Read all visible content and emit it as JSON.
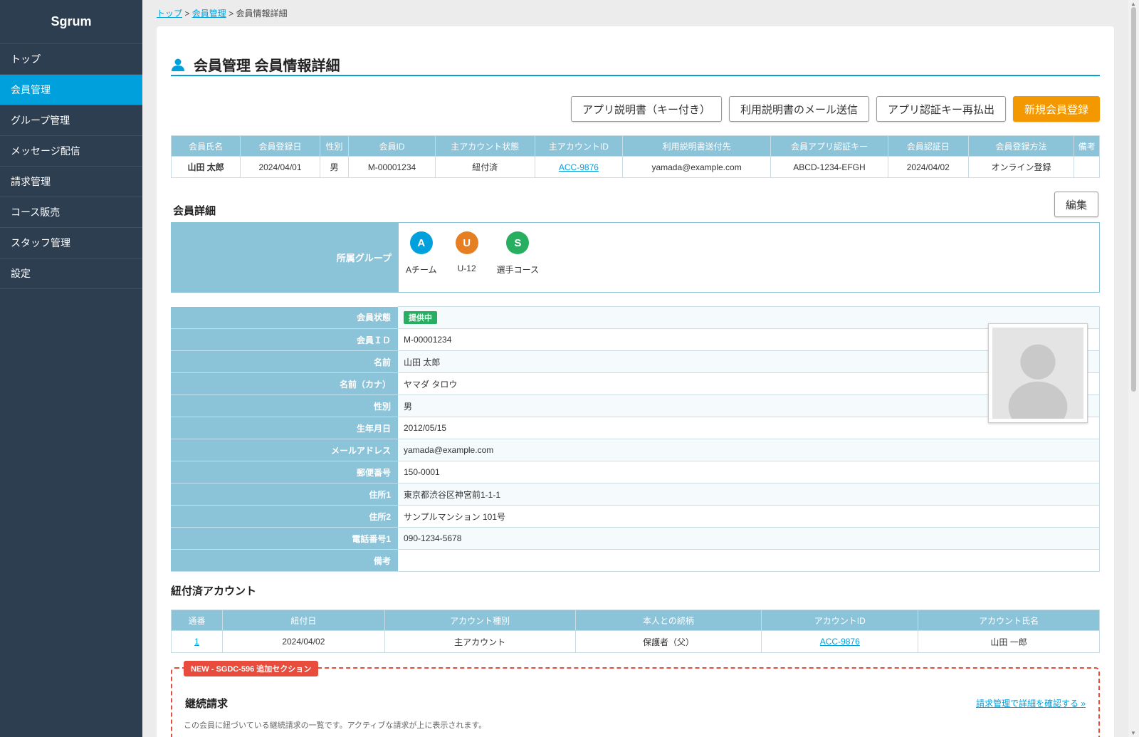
{
  "app": {
    "brand": "Sgrum"
  },
  "sidebar": {
    "items": [
      {
        "label": "トップ"
      },
      {
        "label": "会員管理",
        "active": true
      },
      {
        "label": "グループ管理"
      },
      {
        "label": "メッセージ配信"
      },
      {
        "label": "請求管理"
      },
      {
        "label": "コース販売"
      },
      {
        "label": "スタッフ管理"
      },
      {
        "label": "設定"
      }
    ]
  },
  "breadcrumb": {
    "top": "トップ",
    "sep": ">",
    "members": "会員管理",
    "current": "会員情報詳細"
  },
  "page": {
    "title": "会員管理 会員情報詳細"
  },
  "actions": {
    "manual_with_key": "アプリ説明書（キー付き）",
    "send_manual_mail": "利用説明書のメール送信",
    "reissue_key": "アプリ認証キー再払出",
    "new_member": "新規会員登録"
  },
  "summary": {
    "headers": [
      "会員氏名",
      "会員登録日",
      "性別",
      "会員ID",
      "主アカウント状態",
      "主アカウントID",
      "利用説明書送付先",
      "会員アプリ認証キー",
      "会員認証日",
      "会員登録方法",
      "備考"
    ],
    "row": {
      "name": "山田 太郎",
      "registered": "2024/04/01",
      "gender": "男",
      "member_id": "M-00001234",
      "account_status": "紐付済",
      "account_id": "ACC-9876",
      "manual_to": "yamada@example.com",
      "app_key": "ABCD-1234-EFGH",
      "auth_date": "2024/04/02",
      "reg_method": "オンライン登録",
      "note": ""
    }
  },
  "detail": {
    "section_title": "会員詳細",
    "edit_label": "編集",
    "group_label": "所属グループ",
    "groups": [
      {
        "initial": "A",
        "name": "Aチーム",
        "color": "#00a0dc"
      },
      {
        "initial": "U",
        "name": "U-12",
        "color": "#e67e22"
      },
      {
        "initial": "S",
        "name": "選手コース",
        "color": "#27ae60"
      }
    ],
    "fields": {
      "status": {
        "label": "会員状態",
        "value": "提供中"
      },
      "id": {
        "label": "会員ＩＤ",
        "value": "M-00001234"
      },
      "name": {
        "label": "名前",
        "value": "山田 太郎"
      },
      "kana": {
        "label": "名前（カナ）",
        "value": "ヤマダ タロウ"
      },
      "gender": {
        "label": "性別",
        "value": "男"
      },
      "birthday": {
        "label": "生年月日",
        "value": "2012/05/15"
      },
      "email": {
        "label": "メールアドレス",
        "value": "yamada@example.com"
      },
      "zip": {
        "label": "郵便番号",
        "value": "150-0001"
      },
      "addr1": {
        "label": "住所1",
        "value": "東京都渋谷区神宮前1-1-1"
      },
      "addr2": {
        "label": "住所2",
        "value": "サンプルマンション 101号"
      },
      "tel": {
        "label": "電話番号1",
        "value": "090-1234-5678"
      },
      "note": {
        "label": "備考",
        "value": ""
      }
    },
    "status_color": "#27ae60"
  },
  "accounts": {
    "section_title": "紐付済アカウント",
    "headers": [
      "通番",
      "紐付日",
      "アカウント種別",
      "本人との続柄",
      "アカウントID",
      "アカウント氏名"
    ],
    "row": {
      "no": "1",
      "linked": "2024/04/02",
      "type": "主アカウント",
      "relation": "保護者（父）",
      "account_id": "ACC-9876",
      "name": "山田 一郎"
    }
  },
  "new_section": {
    "tag": "NEW - SGDC-596 追加セクション",
    "title": "継続請求",
    "link": "請求管理で詳細を確認する »",
    "desc": "この会員に紐づいている継続請求の一覧です。アクティブな請求が上に表示されます。"
  },
  "colors": {
    "accent": "#00a0dc",
    "sidebar": "#2c3e50",
    "primary_button": "#f39800",
    "table_header": "#8bc3d9",
    "new_border": "#e74c3c"
  }
}
